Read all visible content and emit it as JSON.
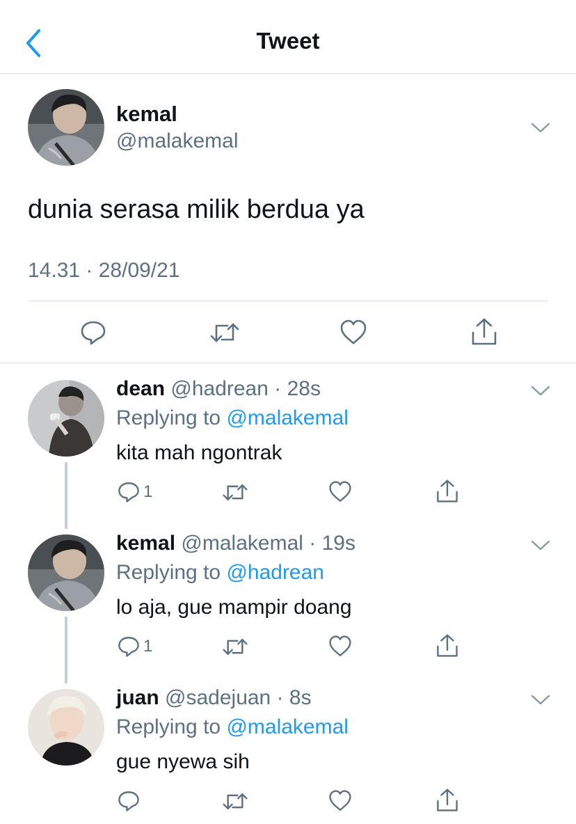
{
  "header": {
    "title": "Tweet",
    "back_icon": "chevron-left-icon",
    "accent": "#1d9bf0"
  },
  "main_tweet": {
    "name": "kemal",
    "handle": "@malakemal",
    "text": "dunia serasa milik berdua ya",
    "timestamp": "14.31 · 28/09/21",
    "actions": [
      "reply-icon",
      "retweet-icon",
      "like-icon",
      "share-icon"
    ]
  },
  "replies": [
    {
      "name": "dean",
      "meta": "@hadrean · 28s",
      "replying_label": "Replying to",
      "replying_to": "@malakemal",
      "text": "kita mah ngontrak",
      "reply_count": "1"
    },
    {
      "name": "kemal",
      "meta": "@malakemal · 19s",
      "replying_label": "Replying to",
      "replying_to": "@hadrean",
      "text": "lo aja, gue mampir doang",
      "reply_count": "1"
    },
    {
      "name": "juan",
      "meta": "@sadejuan · 8s",
      "replying_label": "Replying to",
      "replying_to": "@malakemal",
      "text": "gue nyewa sih",
      "reply_count": ""
    }
  ]
}
